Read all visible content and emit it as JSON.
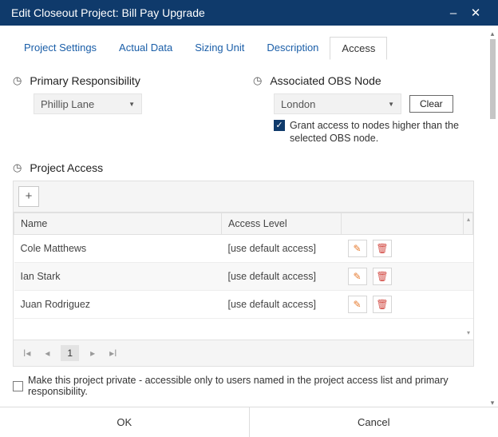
{
  "window": {
    "title": "Edit Closeout Project: Bill Pay Upgrade"
  },
  "tabs": [
    {
      "label": "Project Settings"
    },
    {
      "label": "Actual Data"
    },
    {
      "label": "Sizing Unit"
    },
    {
      "label": "Description"
    },
    {
      "label": "Access"
    }
  ],
  "primary": {
    "heading": "Primary Responsibility",
    "value": "Phillip Lane"
  },
  "obs": {
    "heading": "Associated OBS Node",
    "value": "London",
    "clear": "Clear",
    "grant_text": "Grant access to nodes higher than the selected OBS node."
  },
  "access": {
    "heading": "Project Access",
    "cols": {
      "name": "Name",
      "level": "Access Level"
    },
    "rows": [
      {
        "name": "Cole Matthews",
        "level": "[use default access]"
      },
      {
        "name": "Ian Stark",
        "level": "[use default access]"
      },
      {
        "name": "Juan Rodriguez",
        "level": "[use default access]"
      }
    ],
    "page": "1"
  },
  "private_text": "Make this project private - accessible only to users named in the project access list and primary responsibility.",
  "footer": {
    "ok": "OK",
    "cancel": "Cancel"
  }
}
